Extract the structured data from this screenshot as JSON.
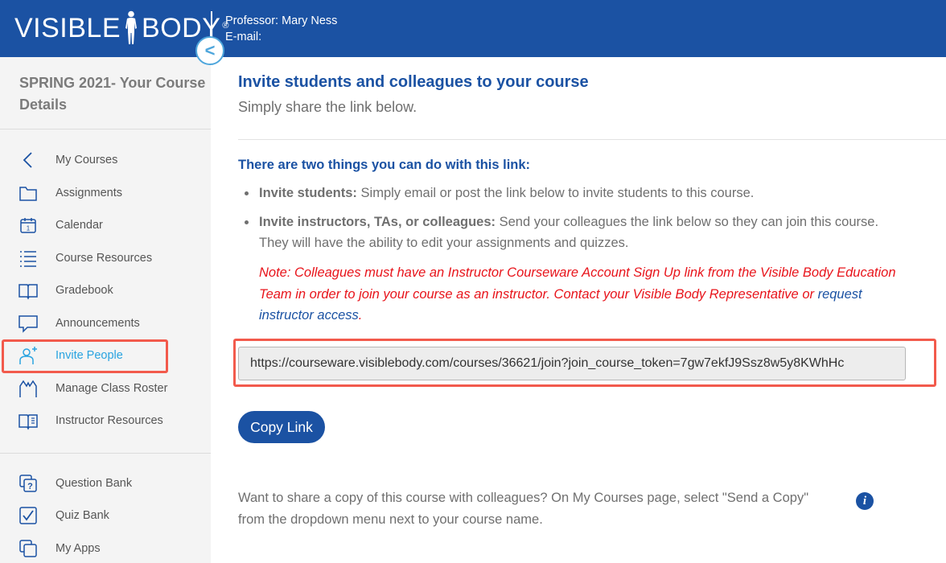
{
  "header": {
    "logo_left": "VISIBLE",
    "logo_right": "BODY",
    "logo_reg": "®",
    "professor": "Professor: Mary Ness",
    "email_label": "E-mail:"
  },
  "sidebar": {
    "course_title": "SPRING 2021- Your Course Details",
    "collapse_symbol": "<",
    "items": [
      {
        "label": "My Courses",
        "icon": "chevron-left-icon"
      },
      {
        "label": "Assignments",
        "icon": "folder-icon"
      },
      {
        "label": "Calendar",
        "icon": "calendar-icon"
      },
      {
        "label": "Course Resources",
        "icon": "list-icon"
      },
      {
        "label": "Gradebook",
        "icon": "book-icon"
      },
      {
        "label": "Announcements",
        "icon": "speech-bubble-icon"
      },
      {
        "label": "Invite People",
        "icon": "add-person-icon",
        "active": true
      },
      {
        "label": "Manage Class Roster",
        "icon": "roster-icon"
      },
      {
        "label": "Instructor Resources",
        "icon": "instructor-book-icon"
      },
      {
        "label": "Question Bank",
        "icon": "question-icon"
      },
      {
        "label": "Quiz Bank",
        "icon": "checkbox-icon"
      },
      {
        "label": "My Apps",
        "icon": "apps-icon"
      }
    ]
  },
  "main": {
    "title": "Invite students and colleagues to your course",
    "subtitle": "Simply share the link below.",
    "two_things": "There are two things you can do with this link:",
    "bullet1_bold": "Invite students:",
    "bullet1_text": " Simply email or post the link below to invite students to this course.",
    "bullet2_bold": "Invite instructors, TAs, or colleagues:",
    "bullet2_text": " Send your colleagues the link below so they can join this course. They will have the ability to edit your assignments and quizzes.",
    "note_text": "Note: Colleagues must have an Instructor Courseware Account Sign Up link from the Visible Body Education Team in order to join your course as an instructor. Contact your Visible Body Representative or ",
    "note_link": "request instructor access",
    "note_end": ".",
    "link_value": "https://courseware.visiblebody.com/courses/36621/join?join_course_token=7gw7ekfJ9Ssz8w5y8KWhHc",
    "copy_label": "Copy Link",
    "share_note": "Want to share a copy of this course with colleagues? On My Courses page, select \"Send a Copy\" from the dropdown menu next to your course name.",
    "info_symbol": "i"
  },
  "colors": {
    "brand_blue": "#1b52a3",
    "accent_light_blue": "#29a3e0",
    "highlight_red": "#f25a4c",
    "note_red": "#e8141b"
  }
}
